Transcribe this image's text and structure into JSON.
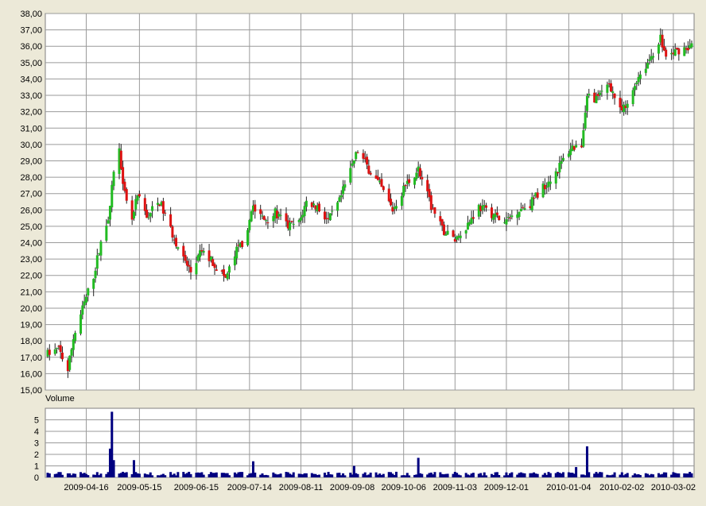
{
  "chart_data": [
    {
      "type": "candlestick",
      "title": "",
      "ylim": [
        15,
        38
      ],
      "y_ticks": [
        "15,00",
        "16,00",
        "17,00",
        "18,00",
        "19,00",
        "20,00",
        "21,00",
        "22,00",
        "23,00",
        "24,00",
        "25,00",
        "26,00",
        "27,00",
        "28,00",
        "29,00",
        "30,00",
        "31,00",
        "32,00",
        "33,00",
        "34,00",
        "35,00",
        "36,00",
        "37,00",
        "38,00"
      ],
      "grid": true,
      "colors": {
        "up": "#22bb22",
        "down": "#dd1111",
        "grid": "#9a9a9a"
      },
      "date_range": [
        "2009-03-26",
        "2010-03-12"
      ],
      "price_points": [
        {
          "date": "2009-03-26",
          "value": 17.2
        },
        {
          "date": "2009-04-01",
          "value": 17.5
        },
        {
          "date": "2009-04-06",
          "value": 16.2
        },
        {
          "date": "2009-04-09",
          "value": 18.2
        },
        {
          "date": "2009-04-15",
          "value": 20.3
        },
        {
          "date": "2009-04-20",
          "value": 22.0
        },
        {
          "date": "2009-04-24",
          "value": 24.0
        },
        {
          "date": "2009-04-29",
          "value": 26.0
        },
        {
          "date": "2009-05-01",
          "value": 28.5
        },
        {
          "date": "2009-05-04",
          "value": 29.6
        },
        {
          "date": "2009-05-07",
          "value": 27.0
        },
        {
          "date": "2009-05-11",
          "value": 25.5
        },
        {
          "date": "2009-05-14",
          "value": 26.8
        },
        {
          "date": "2009-05-19",
          "value": 25.6
        },
        {
          "date": "2009-05-26",
          "value": 26.5
        },
        {
          "date": "2009-06-01",
          "value": 24.8
        },
        {
          "date": "2009-06-08",
          "value": 23.0
        },
        {
          "date": "2009-06-12",
          "value": 22.2
        },
        {
          "date": "2009-06-18",
          "value": 23.5
        },
        {
          "date": "2009-06-24",
          "value": 22.8
        },
        {
          "date": "2009-07-01",
          "value": 21.8
        },
        {
          "date": "2009-07-07",
          "value": 23.5
        },
        {
          "date": "2009-07-13",
          "value": 24.5
        },
        {
          "date": "2009-07-15",
          "value": 26.2
        },
        {
          "date": "2009-07-22",
          "value": 25.4
        },
        {
          "date": "2009-07-28",
          "value": 25.8
        },
        {
          "date": "2009-08-04",
          "value": 25.0
        },
        {
          "date": "2009-08-10",
          "value": 25.2
        },
        {
          "date": "2009-08-14",
          "value": 26.5
        },
        {
          "date": "2009-08-20",
          "value": 26.2
        },
        {
          "date": "2009-08-26",
          "value": 25.3
        },
        {
          "date": "2009-09-01",
          "value": 26.5
        },
        {
          "date": "2009-09-08",
          "value": 28.8
        },
        {
          "date": "2009-09-11",
          "value": 29.6
        },
        {
          "date": "2009-09-17",
          "value": 28.5
        },
        {
          "date": "2009-09-23",
          "value": 27.5
        },
        {
          "date": "2009-09-30",
          "value": 26.0
        },
        {
          "date": "2009-10-07",
          "value": 27.5
        },
        {
          "date": "2009-10-14",
          "value": 28.5
        },
        {
          "date": "2009-10-21",
          "value": 26.2
        },
        {
          "date": "2009-10-27",
          "value": 24.8
        },
        {
          "date": "2009-11-03",
          "value": 24.2
        },
        {
          "date": "2009-11-09",
          "value": 25.0
        },
        {
          "date": "2009-11-16",
          "value": 26.2
        },
        {
          "date": "2009-11-23",
          "value": 25.8
        },
        {
          "date": "2009-11-30",
          "value": 25.2
        },
        {
          "date": "2009-12-07",
          "value": 26.0
        },
        {
          "date": "2009-12-14",
          "value": 26.4
        },
        {
          "date": "2009-12-21",
          "value": 27.4
        },
        {
          "date": "2009-12-29",
          "value": 28.5
        },
        {
          "date": "2010-01-05",
          "value": 29.8
        },
        {
          "date": "2010-01-11",
          "value": 30.0
        },
        {
          "date": "2010-01-14",
          "value": 33.0
        },
        {
          "date": "2010-01-20",
          "value": 32.8
        },
        {
          "date": "2010-01-26",
          "value": 33.8
        },
        {
          "date": "2010-02-01",
          "value": 32.0
        },
        {
          "date": "2010-02-05",
          "value": 32.3
        },
        {
          "date": "2010-02-10",
          "value": 34.0
        },
        {
          "date": "2010-02-16",
          "value": 35.0
        },
        {
          "date": "2010-02-23",
          "value": 36.5
        },
        {
          "date": "2010-02-26",
          "value": 35.3
        },
        {
          "date": "2010-03-05",
          "value": 35.8
        },
        {
          "date": "2010-03-12",
          "value": 36.0
        }
      ]
    },
    {
      "type": "bar",
      "title": "Volume",
      "ylim": [
        0,
        6
      ],
      "y_ticks": [
        "0",
        "1",
        "2",
        "3",
        "4",
        "5"
      ],
      "x_ticks": [
        "2009-04-16",
        "2009-05-15",
        "2009-06-15",
        "2009-07-14",
        "2009-08-11",
        "2009-09-08",
        "2009-10-06",
        "2009-11-03",
        "2009-12-01",
        "2010-01-04",
        "2010-02-02",
        "2010-03-02"
      ],
      "colors": {
        "bar": "#000080"
      },
      "volume_spikes": [
        {
          "date": "2009-04-29",
          "value": 2.5
        },
        {
          "date": "2009-04-30",
          "value": 5.7
        },
        {
          "date": "2009-05-01",
          "value": 1.5
        },
        {
          "date": "2009-05-12",
          "value": 1.5
        },
        {
          "date": "2009-07-16",
          "value": 1.4
        },
        {
          "date": "2009-10-14",
          "value": 1.7
        },
        {
          "date": "2009-09-09",
          "value": 1.0
        },
        {
          "date": "2010-01-14",
          "value": 2.7
        },
        {
          "date": "2010-01-08",
          "value": 0.9
        }
      ],
      "baseline_volume": 0.35
    }
  ]
}
